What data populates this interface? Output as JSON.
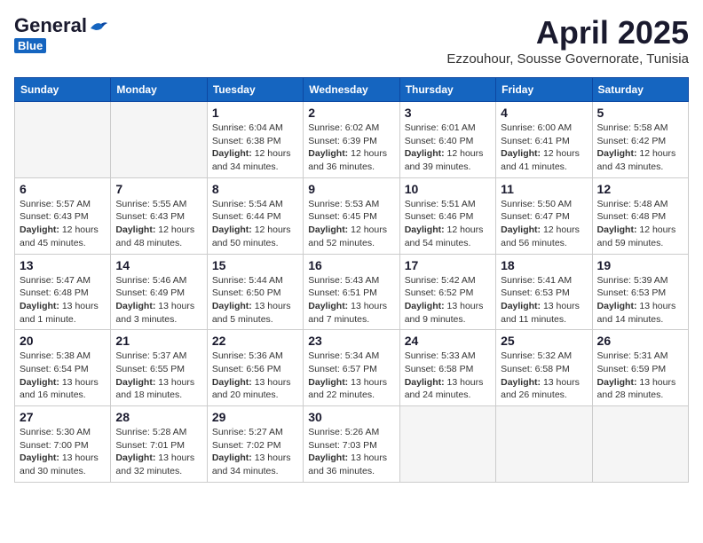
{
  "logo": {
    "general": "General",
    "blue": "Blue"
  },
  "title": "April 2025",
  "location": "Ezzouhour, Sousse Governorate, Tunisia",
  "headers": [
    "Sunday",
    "Monday",
    "Tuesday",
    "Wednesday",
    "Thursday",
    "Friday",
    "Saturday"
  ],
  "weeks": [
    [
      {
        "day": "",
        "info": ""
      },
      {
        "day": "",
        "info": ""
      },
      {
        "day": "1",
        "info": "Sunrise: 6:04 AM\nSunset: 6:38 PM\nDaylight: 12 hours and 34 minutes."
      },
      {
        "day": "2",
        "info": "Sunrise: 6:02 AM\nSunset: 6:39 PM\nDaylight: 12 hours and 36 minutes."
      },
      {
        "day": "3",
        "info": "Sunrise: 6:01 AM\nSunset: 6:40 PM\nDaylight: 12 hours and 39 minutes."
      },
      {
        "day": "4",
        "info": "Sunrise: 6:00 AM\nSunset: 6:41 PM\nDaylight: 12 hours and 41 minutes."
      },
      {
        "day": "5",
        "info": "Sunrise: 5:58 AM\nSunset: 6:42 PM\nDaylight: 12 hours and 43 minutes."
      }
    ],
    [
      {
        "day": "6",
        "info": "Sunrise: 5:57 AM\nSunset: 6:43 PM\nDaylight: 12 hours and 45 minutes."
      },
      {
        "day": "7",
        "info": "Sunrise: 5:55 AM\nSunset: 6:43 PM\nDaylight: 12 hours and 48 minutes."
      },
      {
        "day": "8",
        "info": "Sunrise: 5:54 AM\nSunset: 6:44 PM\nDaylight: 12 hours and 50 minutes."
      },
      {
        "day": "9",
        "info": "Sunrise: 5:53 AM\nSunset: 6:45 PM\nDaylight: 12 hours and 52 minutes."
      },
      {
        "day": "10",
        "info": "Sunrise: 5:51 AM\nSunset: 6:46 PM\nDaylight: 12 hours and 54 minutes."
      },
      {
        "day": "11",
        "info": "Sunrise: 5:50 AM\nSunset: 6:47 PM\nDaylight: 12 hours and 56 minutes."
      },
      {
        "day": "12",
        "info": "Sunrise: 5:48 AM\nSunset: 6:48 PM\nDaylight: 12 hours and 59 minutes."
      }
    ],
    [
      {
        "day": "13",
        "info": "Sunrise: 5:47 AM\nSunset: 6:48 PM\nDaylight: 13 hours and 1 minute."
      },
      {
        "day": "14",
        "info": "Sunrise: 5:46 AM\nSunset: 6:49 PM\nDaylight: 13 hours and 3 minutes."
      },
      {
        "day": "15",
        "info": "Sunrise: 5:44 AM\nSunset: 6:50 PM\nDaylight: 13 hours and 5 minutes."
      },
      {
        "day": "16",
        "info": "Sunrise: 5:43 AM\nSunset: 6:51 PM\nDaylight: 13 hours and 7 minutes."
      },
      {
        "day": "17",
        "info": "Sunrise: 5:42 AM\nSunset: 6:52 PM\nDaylight: 13 hours and 9 minutes."
      },
      {
        "day": "18",
        "info": "Sunrise: 5:41 AM\nSunset: 6:53 PM\nDaylight: 13 hours and 11 minutes."
      },
      {
        "day": "19",
        "info": "Sunrise: 5:39 AM\nSunset: 6:53 PM\nDaylight: 13 hours and 14 minutes."
      }
    ],
    [
      {
        "day": "20",
        "info": "Sunrise: 5:38 AM\nSunset: 6:54 PM\nDaylight: 13 hours and 16 minutes."
      },
      {
        "day": "21",
        "info": "Sunrise: 5:37 AM\nSunset: 6:55 PM\nDaylight: 13 hours and 18 minutes."
      },
      {
        "day": "22",
        "info": "Sunrise: 5:36 AM\nSunset: 6:56 PM\nDaylight: 13 hours and 20 minutes."
      },
      {
        "day": "23",
        "info": "Sunrise: 5:34 AM\nSunset: 6:57 PM\nDaylight: 13 hours and 22 minutes."
      },
      {
        "day": "24",
        "info": "Sunrise: 5:33 AM\nSunset: 6:58 PM\nDaylight: 13 hours and 24 minutes."
      },
      {
        "day": "25",
        "info": "Sunrise: 5:32 AM\nSunset: 6:58 PM\nDaylight: 13 hours and 26 minutes."
      },
      {
        "day": "26",
        "info": "Sunrise: 5:31 AM\nSunset: 6:59 PM\nDaylight: 13 hours and 28 minutes."
      }
    ],
    [
      {
        "day": "27",
        "info": "Sunrise: 5:30 AM\nSunset: 7:00 PM\nDaylight: 13 hours and 30 minutes."
      },
      {
        "day": "28",
        "info": "Sunrise: 5:28 AM\nSunset: 7:01 PM\nDaylight: 13 hours and 32 minutes."
      },
      {
        "day": "29",
        "info": "Sunrise: 5:27 AM\nSunset: 7:02 PM\nDaylight: 13 hours and 34 minutes."
      },
      {
        "day": "30",
        "info": "Sunrise: 5:26 AM\nSunset: 7:03 PM\nDaylight: 13 hours and 36 minutes."
      },
      {
        "day": "",
        "info": ""
      },
      {
        "day": "",
        "info": ""
      },
      {
        "day": "",
        "info": ""
      }
    ]
  ]
}
